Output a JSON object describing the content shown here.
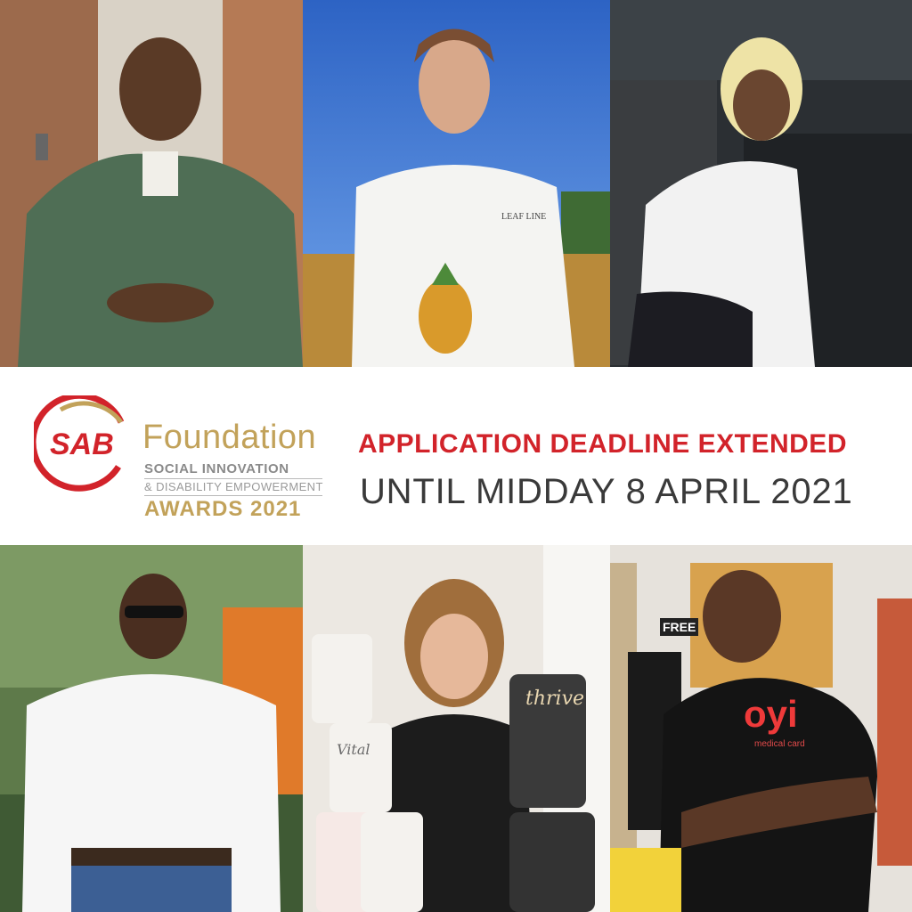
{
  "logo": {
    "brand": "SAB",
    "name": "Foundation",
    "line1": "SOCIAL INNOVATION",
    "line2": "& DISABILITY EMPOWERMENT",
    "line3": "AWARDS 2021"
  },
  "announcement": {
    "headline": "APPLICATION DEADLINE EXTENDED",
    "subline": "UNTIL MIDDAY 8 APRIL 2021"
  },
  "colors": {
    "brand_red": "#d2232a",
    "gold": "#c2a25a",
    "gray_text": "#3a3a3a"
  },
  "photos": {
    "shirt_logo": "LEAF LINE",
    "can_brand_1": "thrive",
    "can_brand_2": "Vital",
    "shirt_brand": "oyi",
    "shirt_sub": "medical card",
    "sign": "FREE"
  }
}
